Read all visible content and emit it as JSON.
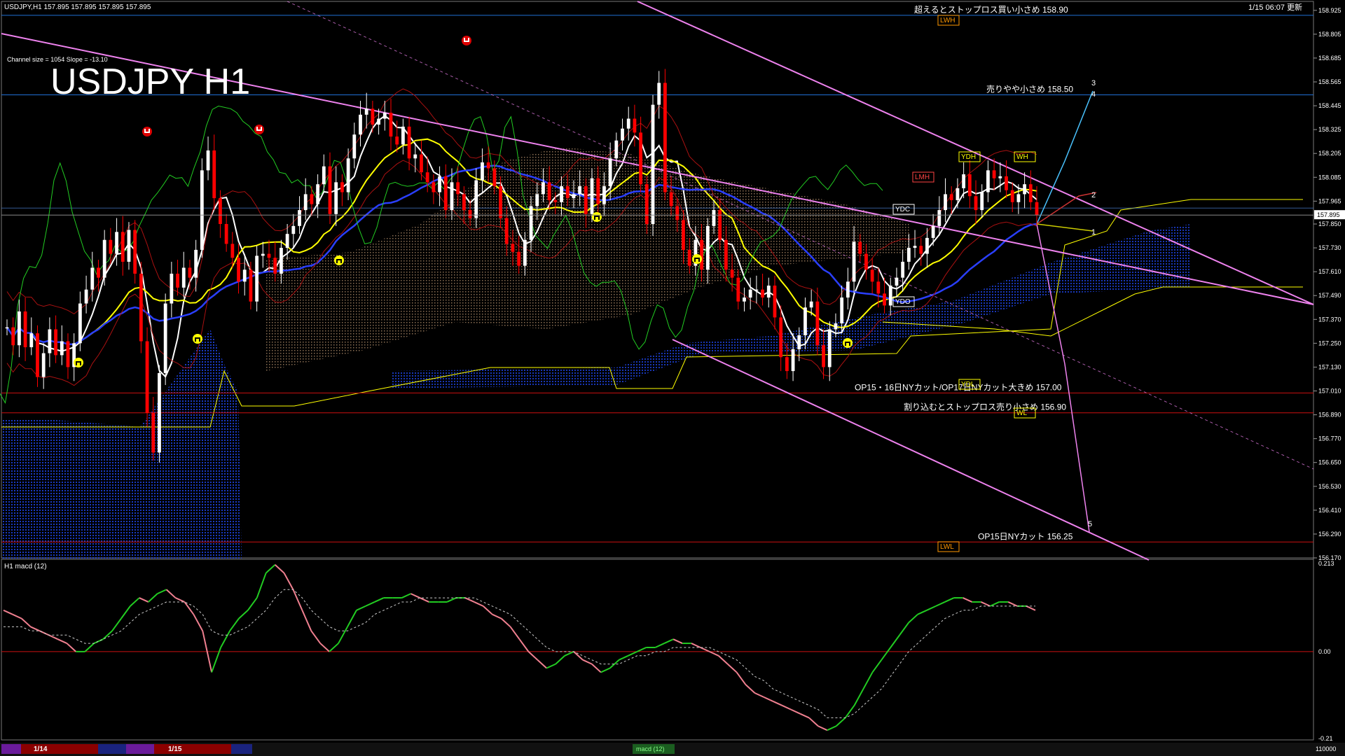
{
  "window": {
    "header_text": "USDJPY,H1  157.895 157.895 157.895 157.895",
    "timestamp": "1/15 06:07 更新",
    "overlay_title": "USDJPY H1",
    "channel_info": "Channel size = 1054 Slope = -13.10"
  },
  "colors": {
    "background": "#000000",
    "bull_candle": "#ffffff",
    "bear_candle": "#ff0000",
    "channel": "#ee82ee",
    "kumo_blue": "#1c3fd6",
    "kumo_brown": "#c8a07a",
    "ma_white": "#ffffff",
    "ma_yellow": "#ffff00",
    "ma_blue": "#2a3fff",
    "chikou_green": "#22cc22",
    "grid_level_red": "#cc1111",
    "grid_level_blue": "#1f6fd6",
    "macd_up": "#22cc22",
    "macd_down": "#f08090",
    "signal": "#cccccc"
  },
  "chart_data": [
    {
      "type": "candlestick",
      "title": "USDJPY H1",
      "symbol": "USDJPY",
      "timeframe": "H1",
      "ylim": [
        156.17,
        158.97
      ],
      "last_price": "157.895",
      "y_ticks": [
        "158.925",
        "158.805",
        "158.685",
        "158.565",
        "158.445",
        "158.325",
        "158.205",
        "158.085",
        "157.965",
        "157.850",
        "157.730",
        "157.610",
        "157.490",
        "157.370",
        "157.250",
        "157.130",
        "157.010",
        "156.890",
        "156.770",
        "156.650",
        "156.530",
        "156.410",
        "156.290",
        "156.170"
      ],
      "x_ticks": [
        "1/14",
        "1/15"
      ],
      "candles_close": [
        157.33,
        157.24,
        157.41,
        157.23,
        157.3,
        157.08,
        157.2,
        157.32,
        157.19,
        157.26,
        157.13,
        157.25,
        157.45,
        157.52,
        157.63,
        157.58,
        157.77,
        157.7,
        157.81,
        157.66,
        157.82,
        157.6,
        157.26,
        156.9,
        156.7,
        157.1,
        157.45,
        157.6,
        157.53,
        157.63,
        157.58,
        157.72,
        158.12,
        158.22,
        157.98,
        157.85,
        157.75,
        157.68,
        157.56,
        157.62,
        157.46,
        157.69,
        157.7,
        157.68,
        157.6,
        157.73,
        157.8,
        157.84,
        157.92,
        158.0,
        157.95,
        158.05,
        158.14,
        157.9,
        158.06,
        158.01,
        158.18,
        158.3,
        158.4,
        158.43,
        158.35,
        158.38,
        158.41,
        158.29,
        158.25,
        158.34,
        158.18,
        158.2,
        158.11,
        158.06,
        158.01,
        158.09,
        157.92,
        158.06,
        158.0,
        157.92,
        157.88,
        158.07,
        158.16,
        158.13,
        158.04,
        157.88,
        157.75,
        157.71,
        157.64,
        157.77,
        157.94,
        158.0,
        158.06,
        157.97,
        157.96,
        158.04,
        157.98,
        158.0,
        158.04,
        157.9,
        158.08,
        157.95,
        158.04,
        158.18,
        158.27,
        158.33,
        158.38,
        158.31,
        158.05,
        157.85,
        158.45,
        158.56,
        158.01,
        157.94,
        157.87,
        157.72,
        157.64,
        157.77,
        157.62,
        157.84,
        157.92,
        157.77,
        157.62,
        157.58,
        157.46,
        157.48,
        157.52,
        157.52,
        157.48,
        157.54,
        157.38,
        157.18,
        157.11,
        157.22,
        157.29,
        157.43,
        157.46,
        157.24,
        157.13,
        157.32,
        157.35,
        157.48,
        157.56,
        157.76,
        157.7,
        157.62,
        157.56,
        157.5,
        157.44,
        157.54,
        157.58,
        157.66,
        157.73,
        157.74,
        157.7,
        157.78,
        157.84,
        157.92,
        158.0,
        157.97,
        158.03,
        158.1,
        157.99,
        157.92,
        158.01,
        158.12,
        158.08,
        158.09,
        158.02,
        157.96,
        158.0,
        158.05,
        157.96,
        157.895
      ],
      "horizontal_levels": [
        {
          "price": 158.9,
          "label": "超えるとストップロス買い小さめ 158.90"
        },
        {
          "price": 158.5,
          "label": "売りやや小さめ 158.50"
        },
        {
          "price": 157.0,
          "label": "OP15・16日NYカット/OP17日NYカット大きめ 157.00"
        },
        {
          "price": 156.9,
          "label": "割り込むとストップロス売り小さめ 156.90"
        },
        {
          "price": 156.25,
          "label": "OP15日NYカット 156.25"
        }
      ],
      "tags": [
        "LWH",
        "YDH",
        "WH",
        "LMH",
        "YDC",
        "YDO",
        "YDL",
        "WL",
        "LWL"
      ],
      "scenario_labels": [
        "1",
        "2",
        "3",
        "4",
        "5"
      ]
    },
    {
      "type": "line",
      "title": "H1 macd (12)",
      "ylim": [
        -0.21,
        0.213
      ],
      "y_ticks": [
        "0.213",
        "0.00",
        "-0.21"
      ],
      "series": [
        {
          "name": "macd",
          "values": [
            0.1,
            0.09,
            0.08,
            0.06,
            0.05,
            0.04,
            0.03,
            0.02,
            0.0,
            0.0,
            0.02,
            0.03,
            0.05,
            0.08,
            0.11,
            0.13,
            0.12,
            0.14,
            0.15,
            0.13,
            0.12,
            0.09,
            0.05,
            -0.05,
            0.01,
            0.05,
            0.08,
            0.1,
            0.13,
            0.19,
            0.21,
            0.19,
            0.15,
            0.1,
            0.05,
            0.02,
            0.0,
            0.02,
            0.06,
            0.1,
            0.11,
            0.12,
            0.13,
            0.13,
            0.13,
            0.14,
            0.13,
            0.12,
            0.12,
            0.12,
            0.13,
            0.13,
            0.12,
            0.11,
            0.09,
            0.08,
            0.06,
            0.03,
            0.0,
            -0.02,
            -0.04,
            -0.03,
            -0.01,
            0.0,
            -0.02,
            -0.03,
            -0.05,
            -0.04,
            -0.02,
            -0.01,
            0.0,
            0.01,
            0.01,
            0.02,
            0.03,
            0.02,
            0.02,
            0.01,
            0.0,
            -0.01,
            -0.03,
            -0.05,
            -0.08,
            -0.1,
            -0.11,
            -0.12,
            -0.13,
            -0.14,
            -0.15,
            -0.16,
            -0.18,
            -0.19,
            -0.18,
            -0.16,
            -0.13,
            -0.09,
            -0.05,
            -0.02,
            0.01,
            0.04,
            0.07,
            0.09,
            0.1,
            0.11,
            0.12,
            0.13,
            0.13,
            0.12,
            0.12,
            0.11,
            0.12,
            0.12,
            0.11,
            0.11,
            0.1
          ]
        },
        {
          "name": "signal",
          "values": [
            0.06,
            0.06,
            0.06,
            0.05,
            0.05,
            0.04,
            0.04,
            0.04,
            0.03,
            0.02,
            0.02,
            0.03,
            0.04,
            0.05,
            0.07,
            0.09,
            0.1,
            0.11,
            0.12,
            0.12,
            0.12,
            0.11,
            0.09,
            0.05,
            0.04,
            0.04,
            0.05,
            0.06,
            0.08,
            0.1,
            0.13,
            0.15,
            0.15,
            0.13,
            0.1,
            0.08,
            0.06,
            0.05,
            0.05,
            0.06,
            0.07,
            0.09,
            0.1,
            0.11,
            0.12,
            0.12,
            0.13,
            0.13,
            0.13,
            0.13,
            0.13,
            0.13,
            0.13,
            0.12,
            0.11,
            0.1,
            0.09,
            0.07,
            0.05,
            0.03,
            0.01,
            0.0,
            0.0,
            0.0,
            -0.01,
            -0.02,
            -0.03,
            -0.03,
            -0.03,
            -0.02,
            -0.01,
            -0.01,
            0.0,
            0.0,
            0.01,
            0.01,
            0.01,
            0.01,
            0.01,
            0.0,
            -0.01,
            -0.02,
            -0.04,
            -0.06,
            -0.07,
            -0.09,
            -0.1,
            -0.11,
            -0.12,
            -0.13,
            -0.14,
            -0.16,
            -0.16,
            -0.16,
            -0.15,
            -0.13,
            -0.11,
            -0.09,
            -0.06,
            -0.03,
            0.0,
            0.02,
            0.04,
            0.06,
            0.08,
            0.09,
            0.1,
            0.1,
            0.11,
            0.11,
            0.11,
            0.11,
            0.11,
            0.11,
            0.11
          ]
        }
      ]
    }
  ],
  "footer": {
    "date_labels": [
      "1/14",
      "1/15"
    ],
    "macd_tab": "macd (12)",
    "bottom_right": "110000"
  }
}
